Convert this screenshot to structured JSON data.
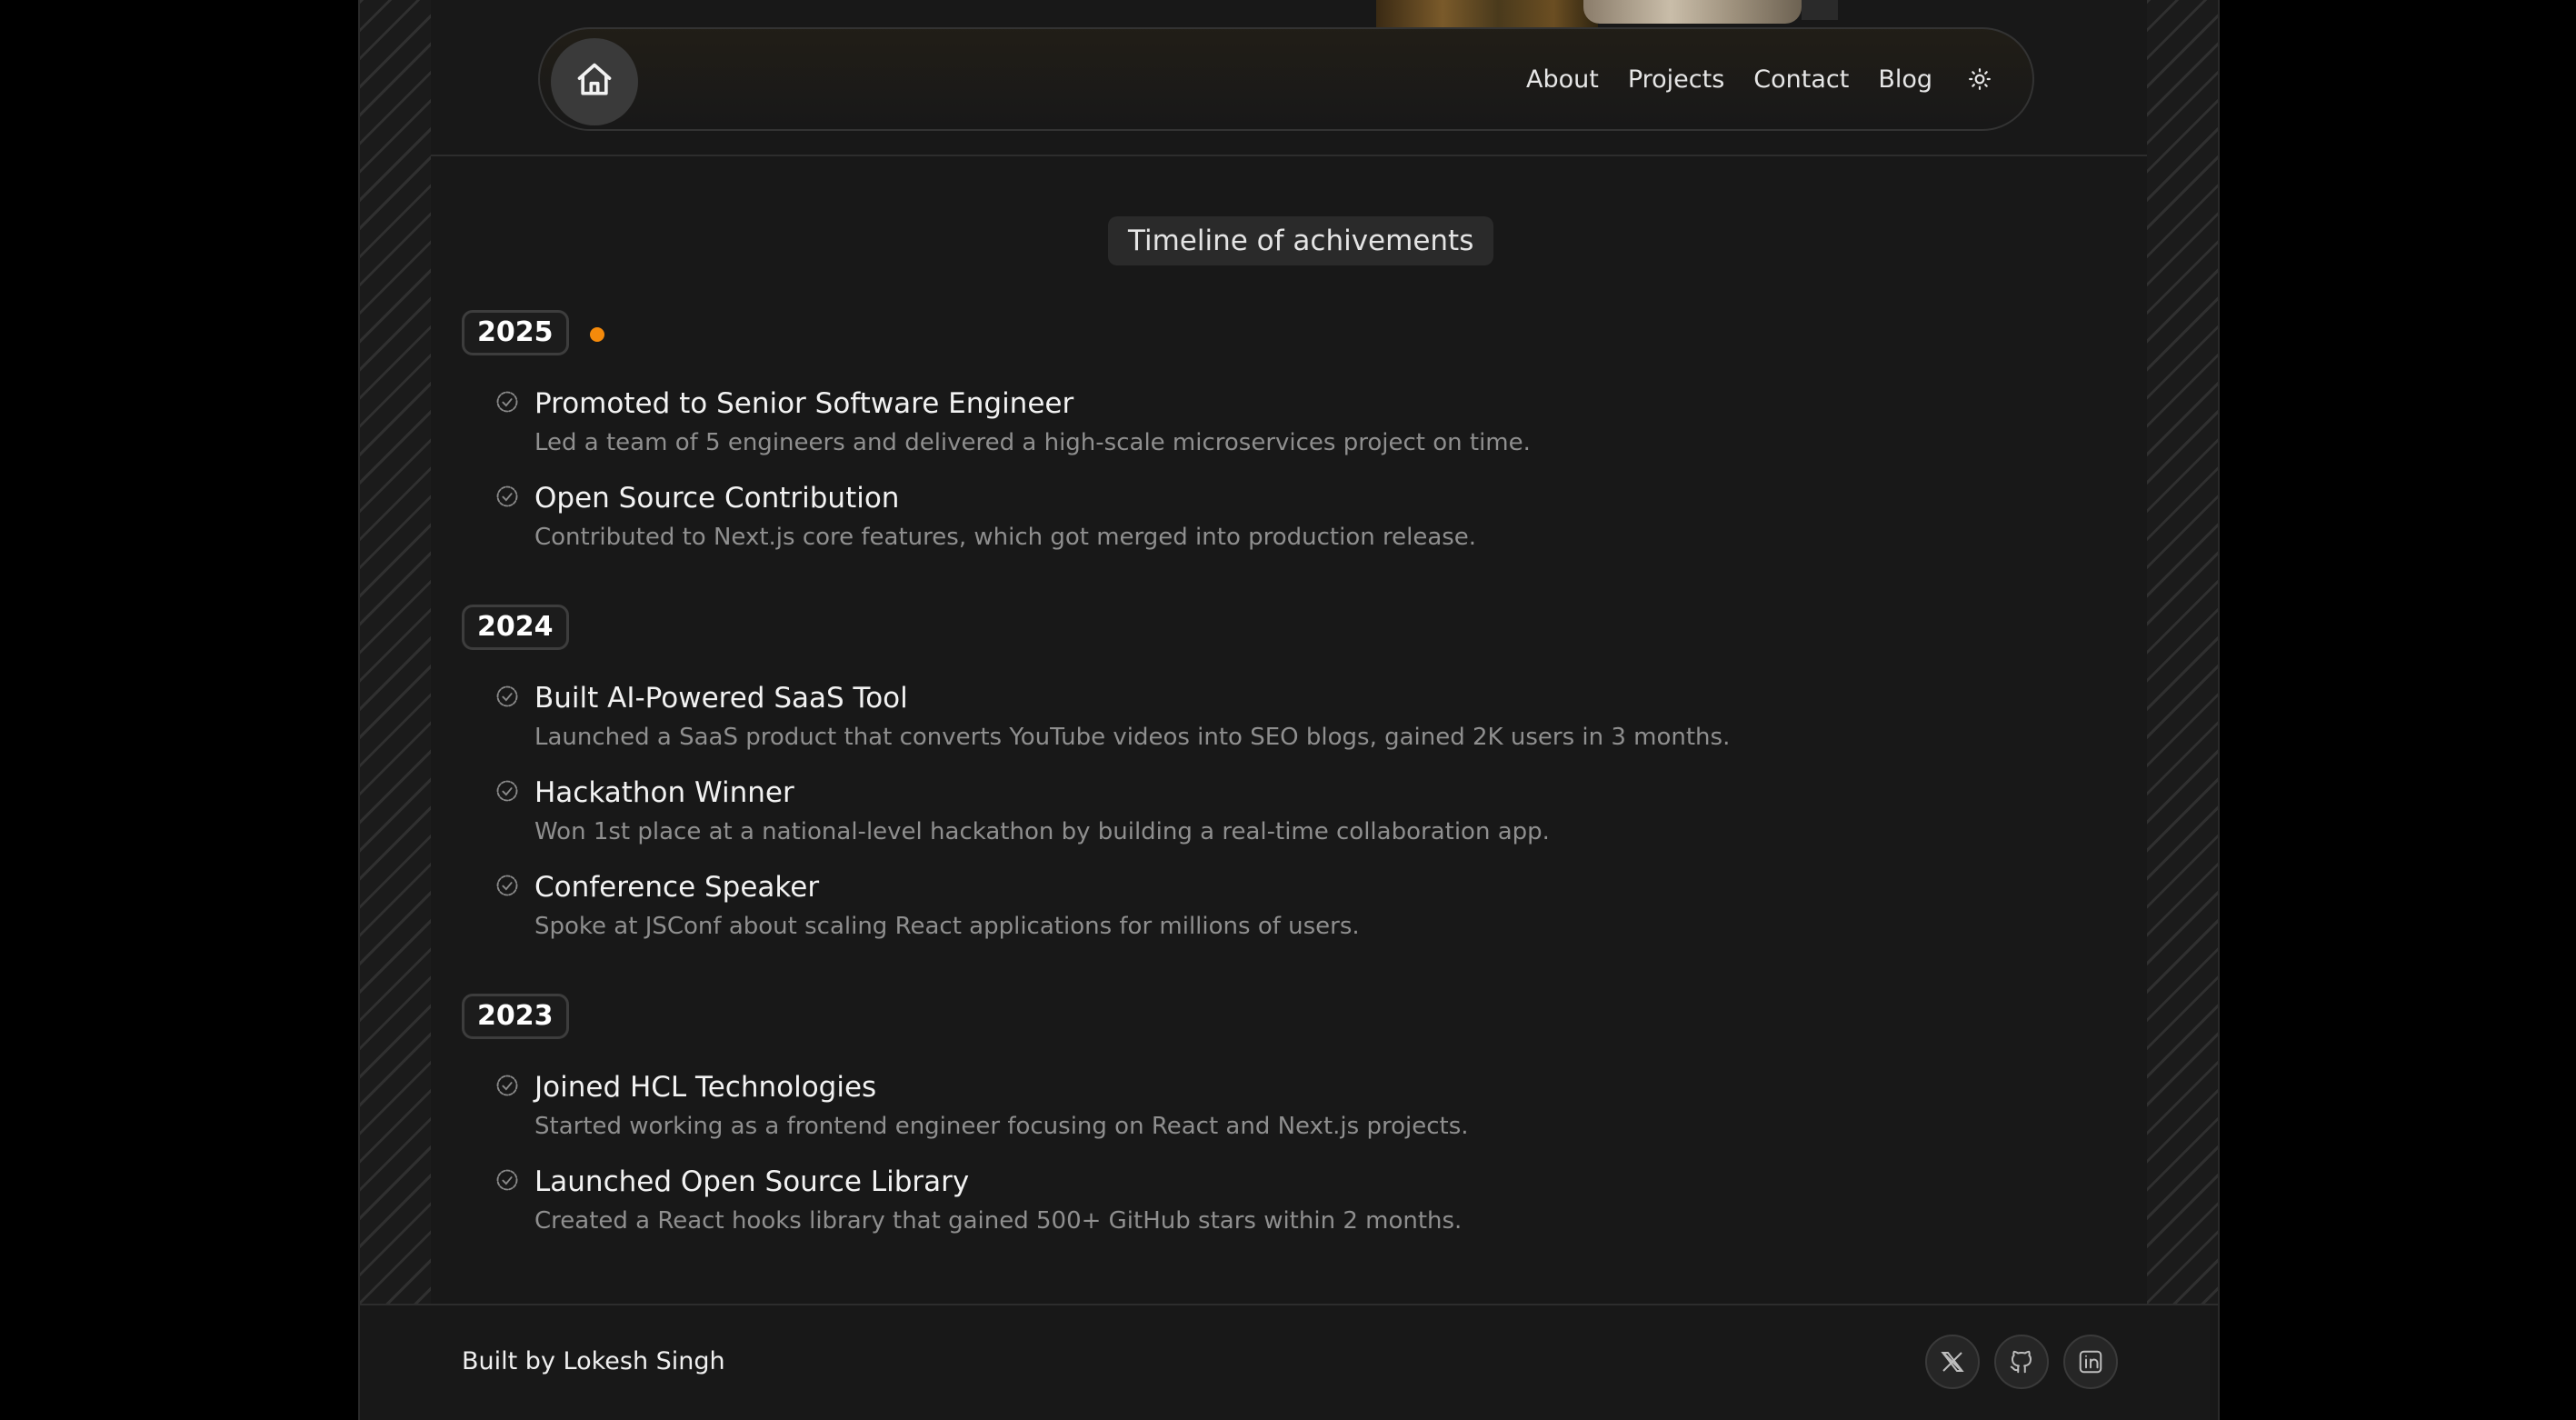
{
  "nav": {
    "links": [
      "About",
      "Projects",
      "Contact",
      "Blog"
    ],
    "home_icon": "home-icon",
    "theme_icon": "sun-icon"
  },
  "heading": "Timeline of achivements",
  "accent_color": "#f58a0b",
  "timeline": [
    {
      "year": "2025",
      "current": true,
      "items": [
        {
          "title": "Promoted to Senior Software Engineer",
          "desc": "Led a team of 5 engineers and delivered a high-scale microservices project on time."
        },
        {
          "title": "Open Source Contribution",
          "desc": "Contributed to Next.js core features, which got merged into production release."
        }
      ]
    },
    {
      "year": "2024",
      "items": [
        {
          "title": "Built AI-Powered SaaS Tool",
          "desc": "Launched a SaaS product that converts YouTube videos into SEO blogs, gained 2K users in 3 months."
        },
        {
          "title": "Hackathon Winner",
          "desc": "Won 1st place at a national-level hackathon by building a real-time collaboration app."
        },
        {
          "title": "Conference Speaker",
          "desc": "Spoke at JSConf about scaling React applications for millions of users."
        }
      ]
    },
    {
      "year": "2023",
      "items": [
        {
          "title": "Joined HCL Technologies",
          "desc": "Started working as a frontend engineer focusing on React and Next.js projects."
        },
        {
          "title": "Launched Open Source Library",
          "desc": "Created a React hooks library that gained 500+ GitHub stars within 2 months."
        }
      ]
    }
  ],
  "footer": {
    "text": "Built by Lokesh Singh",
    "socials": [
      "x-icon",
      "github-icon",
      "linkedin-icon"
    ]
  }
}
